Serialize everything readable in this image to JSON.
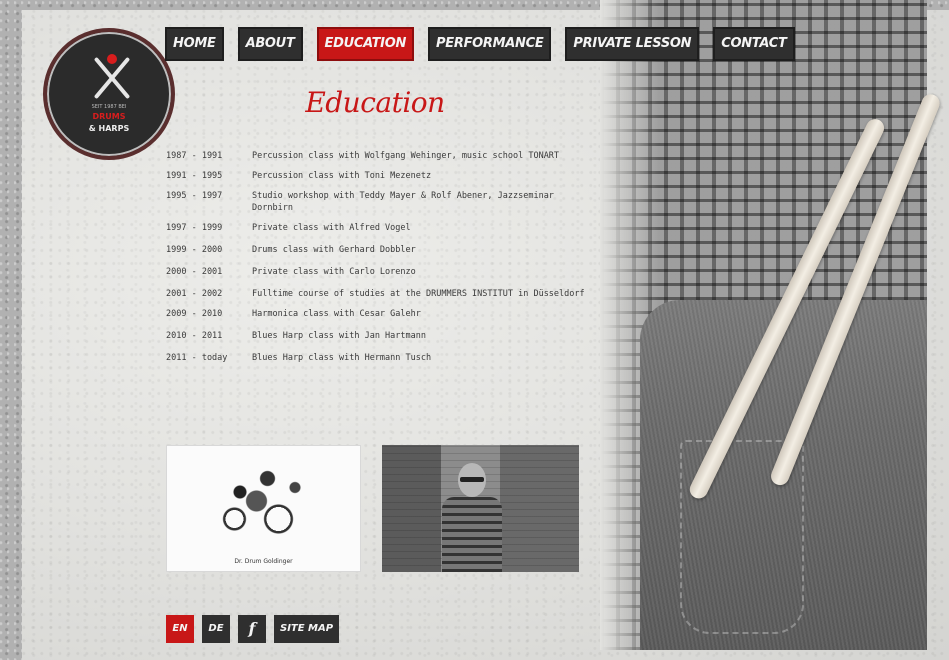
{
  "logo": {
    "line1": "SEIT 1987 BEI",
    "line2": "DRUMS",
    "line3": "& HARPS"
  },
  "nav": {
    "items": [
      {
        "label": "HOME",
        "active": false
      },
      {
        "label": "ABOUT",
        "active": false
      },
      {
        "label": "EDUCATION",
        "active": true
      },
      {
        "label": "PERFORMANCE",
        "active": false
      },
      {
        "label": "PRIVATE LESSON",
        "active": false
      },
      {
        "label": "CONTACT",
        "active": false
      }
    ]
  },
  "main": {
    "title": "Education",
    "education": [
      {
        "years": "1987 - 1991",
        "text": "Percussion class with Wolfgang Wehinger, music school TONART"
      },
      {
        "years": "1991 - 1995",
        "text": "Percussion class with Toni Mezenetz"
      },
      {
        "years": "1995 - 1997",
        "text": "Studio workshop with Teddy Mayer & Rolf Abener, Jazzseminar Dornbirn"
      },
      {
        "years": "1997 - 1999",
        "text": "Private class with Alfred Vogel"
      },
      {
        "years": "1999 - 2000",
        "text": "Drums class with Gerhard Dobbler"
      },
      {
        "years": "2000 - 2001",
        "text": "Private class with Carlo Lorenzo"
      },
      {
        "years": "2001 - 2002",
        "text": "Fulltime course of studies at the DRUMMERS INSTITUT in Düsseldorf"
      },
      {
        "years": "2009 - 2010",
        "text": "Harmonica class with Cesar Galehr"
      },
      {
        "years": "2010 - 2011",
        "text": "Blues Harp class with Jan Hartmann"
      },
      {
        "years": "2011 - today",
        "text": "Blues Harp class with Hermann Tusch"
      }
    ],
    "photo1_caption": "Dr. Drum Goldinger"
  },
  "footer": {
    "en": "EN",
    "de": "DE",
    "facebook": "f",
    "sitemap": "SITE MAP"
  },
  "colors": {
    "accent": "#c81717",
    "button_dark": "#2f2f2f"
  }
}
